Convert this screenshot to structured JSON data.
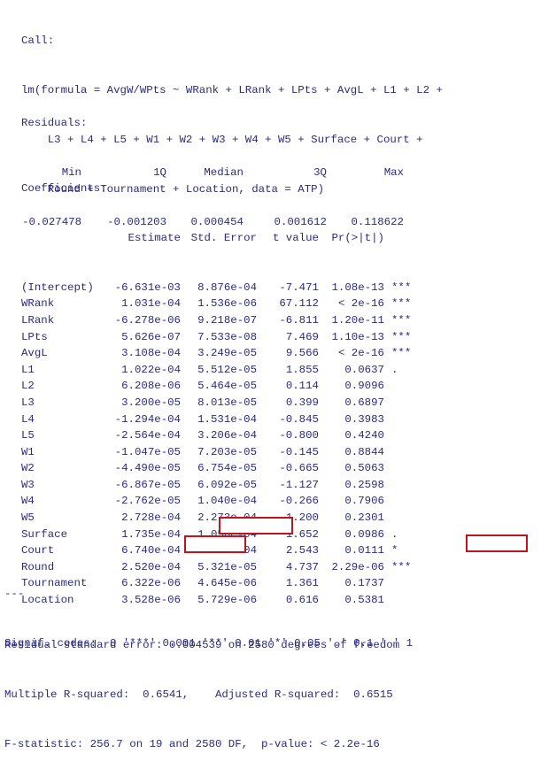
{
  "call": {
    "label": "Call:",
    "formula_lines": [
      "lm(formula = AvgW/WPts ~ WRank + LRank + LPts + AvgL + L1 + L2 +",
      "    L3 + L4 + L5 + W1 + W2 + W3 + W4 + W5 + Surface + Court +",
      "    Round + Tournament + Location, data = ATP)"
    ]
  },
  "residuals": {
    "label": "Residuals:",
    "headers": [
      "Min",
      "1Q",
      "Median",
      "3Q",
      "Max"
    ],
    "values": [
      "-0.027478",
      "-0.001203",
      "0.000454",
      "0.001612",
      "0.118622"
    ]
  },
  "coefficients": {
    "label": "Coefficients:",
    "headers": [
      "",
      "Estimate",
      "Std. Error",
      "t value",
      "Pr(>|t|)",
      ""
    ],
    "rows": [
      {
        "name": "(Intercept)",
        "estimate": "-6.631e-03",
        "std_error": "8.876e-04",
        "t_value": "-7.471",
        "p_value": "1.08e-13",
        "signif": "***"
      },
      {
        "name": "WRank",
        "estimate": "1.031e-04",
        "std_error": "1.536e-06",
        "t_value": "67.112",
        "p_value": "< 2e-16",
        "signif": "***"
      },
      {
        "name": "LRank",
        "estimate": "-6.278e-06",
        "std_error": "9.218e-07",
        "t_value": "-6.811",
        "p_value": "1.20e-11",
        "signif": "***"
      },
      {
        "name": "LPts",
        "estimate": "5.626e-07",
        "std_error": "7.533e-08",
        "t_value": "7.469",
        "p_value": "1.10e-13",
        "signif": "***"
      },
      {
        "name": "AvgL",
        "estimate": "3.108e-04",
        "std_error": "3.249e-05",
        "t_value": "9.566",
        "p_value": "< 2e-16",
        "signif": "***"
      },
      {
        "name": "L1",
        "estimate": "1.022e-04",
        "std_error": "5.512e-05",
        "t_value": "1.855",
        "p_value": "0.0637",
        "signif": "."
      },
      {
        "name": "L2",
        "estimate": "6.208e-06",
        "std_error": "5.464e-05",
        "t_value": "0.114",
        "p_value": "0.9096",
        "signif": ""
      },
      {
        "name": "L3",
        "estimate": "3.200e-05",
        "std_error": "8.013e-05",
        "t_value": "0.399",
        "p_value": "0.6897",
        "signif": ""
      },
      {
        "name": "L4",
        "estimate": "-1.294e-04",
        "std_error": "1.531e-04",
        "t_value": "-0.845",
        "p_value": "0.3983",
        "signif": ""
      },
      {
        "name": "L5",
        "estimate": "-2.564e-04",
        "std_error": "3.206e-04",
        "t_value": "-0.800",
        "p_value": "0.4240",
        "signif": ""
      },
      {
        "name": "W1",
        "estimate": "-1.047e-05",
        "std_error": "7.203e-05",
        "t_value": "-0.145",
        "p_value": "0.8844",
        "signif": ""
      },
      {
        "name": "W2",
        "estimate": "-4.490e-05",
        "std_error": "6.754e-05",
        "t_value": "-0.665",
        "p_value": "0.5063",
        "signif": ""
      },
      {
        "name": "W3",
        "estimate": "-6.867e-05",
        "std_error": "6.092e-05",
        "t_value": "-1.127",
        "p_value": "0.2598",
        "signif": ""
      },
      {
        "name": "W4",
        "estimate": "-2.762e-05",
        "std_error": "1.040e-04",
        "t_value": "-0.266",
        "p_value": "0.7906",
        "signif": ""
      },
      {
        "name": "W5",
        "estimate": "2.728e-04",
        "std_error": "2.273e-04",
        "t_value": "1.200",
        "p_value": "0.2301",
        "signif": ""
      },
      {
        "name": "Surface",
        "estimate": "1.735e-04",
        "std_error": "1.050e-04",
        "t_value": "1.652",
        "p_value": "0.0986",
        "signif": "."
      },
      {
        "name": "Court",
        "estimate": "6.740e-04",
        "std_error": "2.651e-04",
        "t_value": "2.543",
        "p_value": "0.0111",
        "signif": "*"
      },
      {
        "name": "Round",
        "estimate": "2.520e-04",
        "std_error": "5.321e-05",
        "t_value": "4.737",
        "p_value": "2.29e-06",
        "signif": "***"
      },
      {
        "name": "Tournament",
        "estimate": "6.322e-06",
        "std_error": "4.645e-06",
        "t_value": "1.361",
        "p_value": "0.1737",
        "signif": ""
      },
      {
        "name": "Location",
        "estimate": "3.528e-06",
        "std_error": "5.729e-06",
        "t_value": "0.616",
        "p_value": "0.5381",
        "signif": ""
      }
    ]
  },
  "signif": {
    "separator": "---",
    "codes_line": "Signif. codes:  0 '***' 0.001 '**' 0.01 '*' 0.05 '.' 0.1 ' ' 1"
  },
  "summary": {
    "residual_se": "Residual standard error: 0.004539 on 2580 degrees of freedom",
    "r_squared": "Multiple R-squared:  0.6541,\tAdjusted R-squared:  0.6515",
    "f_statistic": "F-statistic: 256.7 on 19 and 2580 DF,  p-value: < 2.2e-16"
  },
  "annotations": {
    "highlight_color": "#c0141c",
    "text_color": "#2b2b80"
  }
}
